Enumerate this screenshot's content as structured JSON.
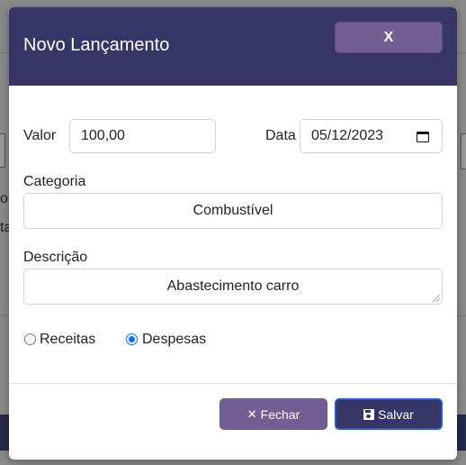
{
  "background": {
    "left_glyph_1": "o",
    "left_glyph_2": "ta"
  },
  "modal": {
    "title": "Novo Lançamento",
    "close_label": "X",
    "valor": {
      "label": "Valor",
      "value": "100,00"
    },
    "data": {
      "label": "Data",
      "value": "05/12/2023"
    },
    "categoria": {
      "label": "Categoria",
      "value": "Combustível"
    },
    "descricao": {
      "label": "Descrição",
      "value": "Abastecimento carro"
    },
    "tipo": {
      "options": [
        {
          "label": "Receitas",
          "checked": false
        },
        {
          "label": "Despesas",
          "checked": true
        }
      ]
    },
    "footer": {
      "fechar_icon": "✕",
      "fechar_label": "Fechar",
      "salvar_label": "Salvar"
    }
  },
  "colors": {
    "header_bg": "#363566",
    "secondary_button": "#735e94",
    "primary_button": "#363566",
    "radio_accent": "#0d6efd"
  }
}
